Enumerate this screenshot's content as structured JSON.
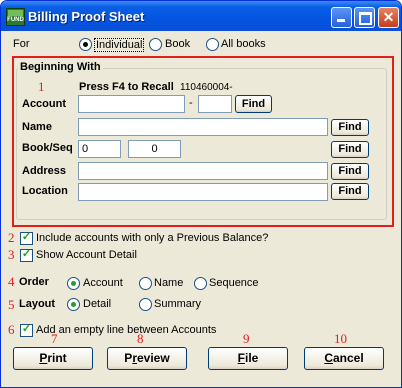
{
  "window": {
    "title": "Billing Proof Sheet",
    "app_icon_text": "FUND"
  },
  "for": {
    "label": "For",
    "options": [
      "Individual",
      "Book",
      "All books"
    ],
    "selected": "Individual"
  },
  "beginning_with": {
    "group_label": "Beginning With",
    "recall_hint": "Press F4 to Recall",
    "recall_value": "110460004-",
    "account_label": "Account",
    "account_separator": "-",
    "name_label": "Name",
    "bookseq_label": "Book/Seq",
    "book_value": "0",
    "seq_value": "0",
    "address_label": "Address",
    "location_label": "Location",
    "find_label": "Find"
  },
  "options": {
    "prev_balance_label": "Include accounts with only a Previous Balance?",
    "prev_balance_checked": true,
    "show_detail_label": "Show Account Detail",
    "show_detail_checked": true,
    "empty_line_label": "Add an empty line between Accounts",
    "empty_line_checked": true
  },
  "order": {
    "label": "Order",
    "options": [
      "Account",
      "Name",
      "Sequence"
    ],
    "selected": "Account"
  },
  "layout": {
    "label": "Layout",
    "options": [
      "Detail",
      "Summary"
    ],
    "selected": "Detail"
  },
  "buttons": {
    "print": {
      "pre": "",
      "key": "P",
      "post": "rint"
    },
    "preview": {
      "pre": "P",
      "key": "r",
      "post": "eview"
    },
    "file": {
      "pre": "",
      "key": "F",
      "post": "ile"
    },
    "cancel": {
      "pre": "",
      "key": "C",
      "post": "ancel"
    }
  },
  "annotations": [
    "1",
    "2",
    "3",
    "4",
    "5",
    "6",
    "7",
    "8",
    "9",
    "10"
  ],
  "colors": {
    "annotation": "#e0201b",
    "titlebar": "#0a5fe6",
    "dialog_bg": "#ece9d8"
  }
}
